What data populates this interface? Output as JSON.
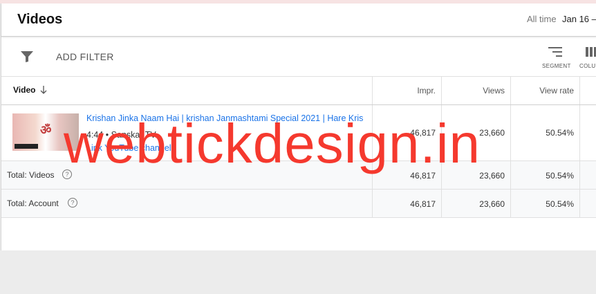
{
  "header": {
    "title": "Videos",
    "period_label": "All time",
    "date_range": "Jan 16 –"
  },
  "toolbar": {
    "add_filter_label": "ADD FILTER",
    "segment_label": "SEGMENT",
    "columns_label": "COLUM"
  },
  "table": {
    "columns": [
      "Video",
      "Impr.",
      "Views",
      "View rate"
    ],
    "video_row": {
      "title": "Krishan Jinka Naam Hai | krishan Janmashtami Special 2021 | Hare Kris",
      "meta": "4:44 • Sanskar TV",
      "link": "Link YouTube channel",
      "impressions": "46,817",
      "views": "23,660",
      "view_rate": "50.54%"
    },
    "totals": [
      {
        "label": "Total: Videos",
        "impressions": "46,817",
        "views": "23,660",
        "view_rate": "50.54%"
      },
      {
        "label": "Total: Account",
        "impressions": "46,817",
        "views": "23,660",
        "view_rate": "50.54%"
      }
    ]
  },
  "watermark": "webtickdesign.in"
}
